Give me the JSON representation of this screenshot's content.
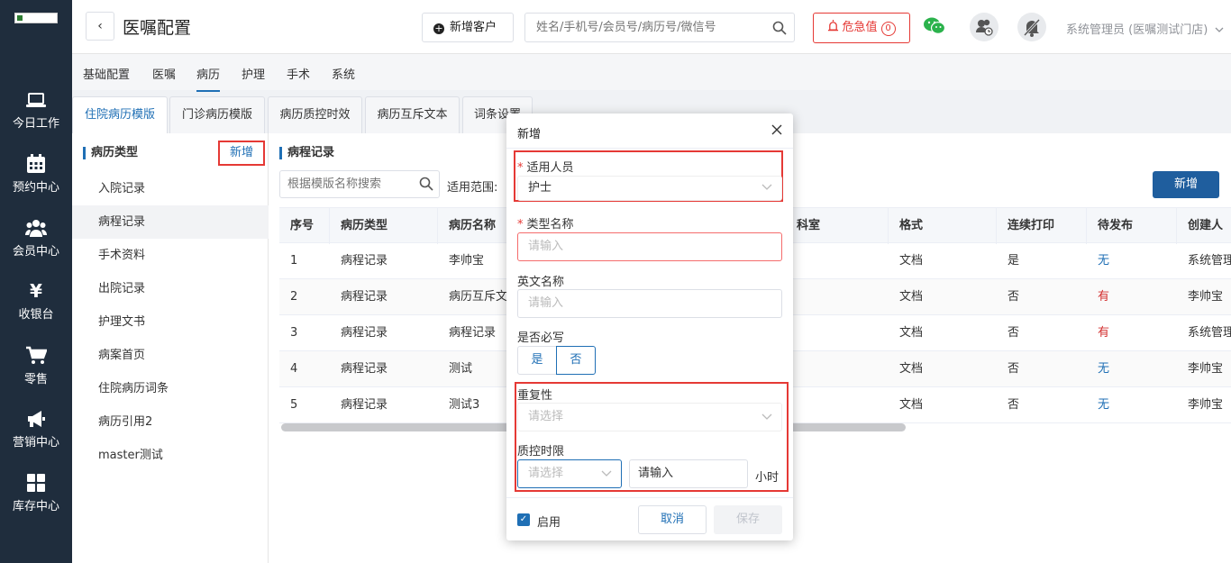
{
  "sidebar": {
    "items": [
      {
        "label": "今日工作",
        "icon": "laptop-icon"
      },
      {
        "label": "预约中心",
        "icon": "calendar-icon"
      },
      {
        "label": "会员中心",
        "icon": "users-icon"
      },
      {
        "label": "收银台",
        "icon": "yen-icon"
      },
      {
        "label": "零售",
        "icon": "cart-icon"
      },
      {
        "label": "营销中心",
        "icon": "megaphone-icon"
      },
      {
        "label": "库存中心",
        "icon": "grid-icon"
      }
    ]
  },
  "header": {
    "back": "‹",
    "title": "医嘱配置",
    "new_customer": "新增客户",
    "search_placeholder": "姓名/手机号/会员号/病历号/微信号",
    "critical_label": "危急值",
    "critical_count": "0",
    "user": "系统管理员 (医嘱测试门店)"
  },
  "subnav": [
    "基础配置",
    "医嘱",
    "病历",
    "护理",
    "手术",
    "系统"
  ],
  "tabs": [
    "住院病历模版",
    "门诊病历模版",
    "病历质控时效",
    "病历互斥文本",
    "词条设置"
  ],
  "left": {
    "title": "病历类型",
    "add": "新增",
    "items": [
      "入院记录",
      "病程记录",
      "手术资料",
      "出院记录",
      "护理文书",
      "病案首页",
      "住院病历词条",
      "病历引用2",
      "master测试"
    ]
  },
  "right": {
    "title": "病程记录",
    "search_placeholder": "根据模版名称搜索",
    "scope_label": "适用范围:",
    "add": "新增",
    "columns": [
      "序号",
      "病历类型",
      "病历名称",
      "科室",
      "格式",
      "连续打印",
      "待发布",
      "创建人"
    ],
    "rows": [
      {
        "no": "1",
        "type": "病程记录",
        "name": "李帅宝",
        "format": "文档",
        "print": "是",
        "pending": "无",
        "creator": "系统管理员"
      },
      {
        "no": "2",
        "type": "病程记录",
        "name": "病历互斥文本",
        "format": "文档",
        "print": "否",
        "pending": "有",
        "creator": "李帅宝"
      },
      {
        "no": "3",
        "type": "病程记录",
        "name": "病程记录",
        "format": "文档",
        "print": "否",
        "pending": "有",
        "creator": "系统管理员"
      },
      {
        "no": "4",
        "type": "病程记录",
        "name": "测试",
        "format": "文档",
        "print": "否",
        "pending": "无",
        "creator": "李帅宝"
      },
      {
        "no": "5",
        "type": "病程记录",
        "name": "测试3",
        "format": "文档",
        "print": "否",
        "pending": "无",
        "creator": "李帅宝"
      }
    ]
  },
  "dialog": {
    "title": "新增",
    "applicable_label": "适用人员",
    "applicable_value": "护士",
    "type_name_label": "类型名称",
    "type_name_placeholder": "请输入",
    "english_label": "英文名称",
    "english_placeholder": "请输入",
    "required_label": "是否必写",
    "yes": "是",
    "no": "否",
    "repeat_label": "重复性",
    "repeat_placeholder": "请选择",
    "qc_label": "质控时限",
    "qc_select_placeholder": "请选择",
    "qc_input_placeholder": "请输入",
    "qc_unit": "小时",
    "enable": "启用",
    "cancel": "取消",
    "save": "保存"
  },
  "colors": {
    "primary": "#1f6fb5",
    "danger": "#e53935",
    "sidebar": "#1f2d3d"
  }
}
